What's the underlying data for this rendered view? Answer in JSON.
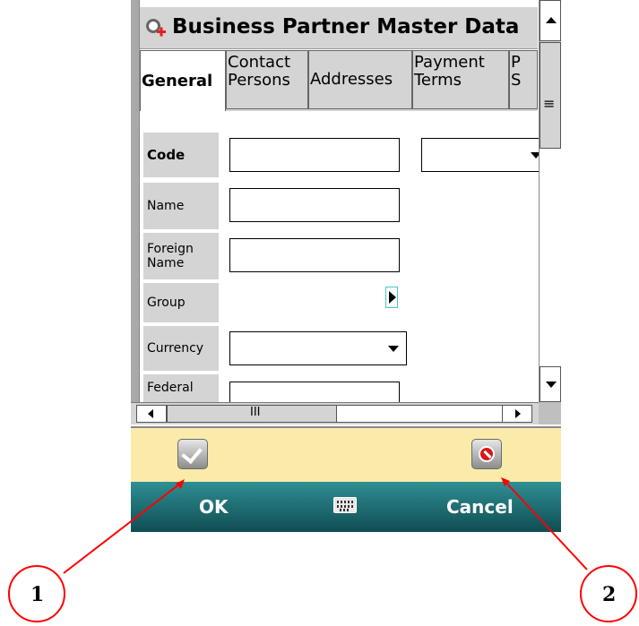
{
  "title": {
    "text": "Business Partner Master Data",
    "icon": "search-add-icon"
  },
  "tabs": [
    {
      "label": "General",
      "active": true
    },
    {
      "label": "Contact\nPersons",
      "active": false
    },
    {
      "label": "Addresses",
      "active": false
    },
    {
      "label": "Payment\nTerms",
      "active": false
    },
    {
      "label": "P\nS",
      "active": false
    }
  ],
  "form": {
    "code_label": "Code",
    "name_label": "Name",
    "foreign_name_label": "Foreign\nName",
    "group_label": "Group",
    "currency_label": "Currency",
    "federal_label": "Federal",
    "code_value": "",
    "name_value": "",
    "foreign_name_value": "",
    "currency_value": "",
    "federal_value": "",
    "code_series_value": ""
  },
  "scrollbar": {
    "grip_vertical": "≡",
    "grip_horizontal": "III"
  },
  "actions": {
    "ok_icon": "checkmark-icon",
    "cancel_icon": "cancel-icon"
  },
  "softkeys": {
    "left": "OK",
    "center_icon": "keyboard-icon",
    "right": "Cancel"
  },
  "callouts": [
    {
      "label": "1"
    },
    {
      "label": "2"
    }
  ],
  "colors": {
    "action_bar": "#faebaa",
    "softkey_bar": "#1f6b70",
    "annotation": "#ff0000"
  }
}
